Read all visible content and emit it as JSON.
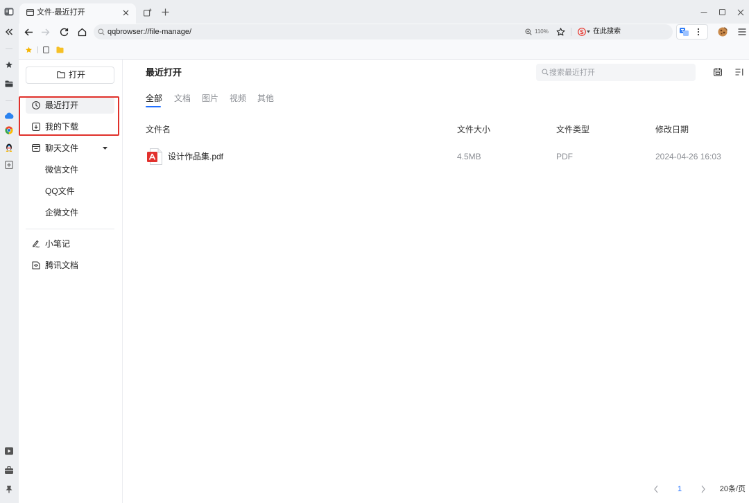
{
  "browser": {
    "app_icon": "reader-mode-icon",
    "tab": {
      "title": "文件-最近打开",
      "icon": "page-icon",
      "close_icon": "close-icon"
    },
    "tab_group_icon": "tab-group-icon",
    "new_tab_icon": "plus-icon",
    "window_controls": [
      "minimize-icon",
      "maximize-icon",
      "close-icon"
    ],
    "toolbar": {
      "collapse_icon": "double-chevron-left-icon",
      "back_icon": "arrow-left-icon",
      "forward_icon": "arrow-right-icon",
      "reload_icon": "reload-icon",
      "home_icon": "home-icon",
      "address": "qqbrowser://file-manage/",
      "zoom": "110%",
      "bookmark_icon": "star-outline-icon",
      "search_engine_icon": "sogou-icon",
      "search_placeholder": "在此搜索",
      "translate_icon": "translate-icon",
      "more_icon": "kebab-icon",
      "avatar_icon": "avatar-icon",
      "menu_icon": "menu-icon"
    },
    "bookmarks_bar": [
      "star-icon",
      "page-icon",
      "folder-icon"
    ],
    "side_rail": {
      "top": [
        "star-icon",
        "wallet-icon",
        "cloud-icon",
        "chrome-icon",
        "qq-icon",
        "add-box-icon"
      ],
      "bottom": [
        "video-icon",
        "briefcase-icon",
        "pin-icon"
      ]
    },
    "colors": {
      "accent": "#1f6fff",
      "annotation": "#e0302a",
      "pdf": "#e2312d",
      "chrome": "#eceef1"
    }
  },
  "file_manager": {
    "open_button": {
      "label": "打开",
      "icon": "folder-open-icon"
    },
    "nav": [
      {
        "label": "最近打开",
        "icon": "clock-icon",
        "active": true
      },
      {
        "label": "我的下载",
        "icon": "download-icon",
        "active": false
      },
      {
        "label": "聊天文件",
        "icon": "chat-folder-icon",
        "expanded": true,
        "children": [
          "微信文件",
          "QQ文件",
          "企微文件"
        ]
      },
      {
        "label": "小笔记",
        "icon": "pen-icon"
      },
      {
        "label": "腾讯文档",
        "icon": "docs-icon"
      }
    ],
    "main": {
      "title": "最近打开",
      "search_placeholder": "搜索最近打开",
      "toolbar_icons": [
        "calendar-icon",
        "sort-icon"
      ],
      "tabs": [
        {
          "label": "全部",
          "active": true
        },
        {
          "label": "文档"
        },
        {
          "label": "图片"
        },
        {
          "label": "视频"
        },
        {
          "label": "其他"
        }
      ],
      "columns": [
        "文件名",
        "文件大小",
        "文件类型",
        "修改日期"
      ],
      "rows": [
        {
          "icon": "pdf-icon",
          "name": "设计作品集.pdf",
          "size": "4.5MB",
          "type": "PDF",
          "modified": "2024-04-26 16:03"
        }
      ],
      "pagination": {
        "page": "1",
        "page_size": "20条/页"
      }
    }
  }
}
